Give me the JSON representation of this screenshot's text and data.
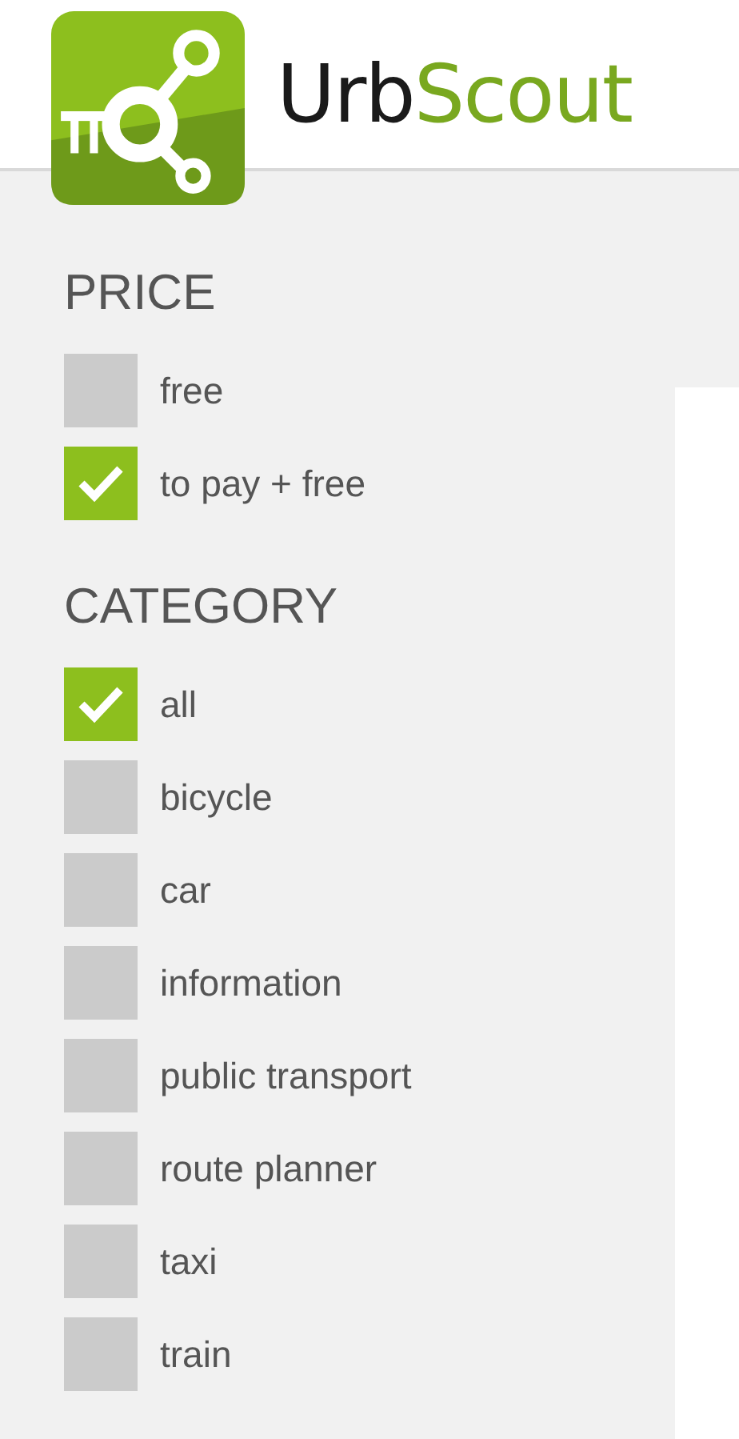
{
  "brand": {
    "dark": "Urb",
    "accent": "Scout"
  },
  "sections": [
    {
      "heading": "PRICE",
      "options": [
        {
          "label": "free",
          "checked": false
        },
        {
          "label": "to pay + free",
          "checked": true
        }
      ]
    },
    {
      "heading": "CATEGORY",
      "options": [
        {
          "label": "all",
          "checked": true
        },
        {
          "label": "bicycle",
          "checked": false
        },
        {
          "label": "car",
          "checked": false
        },
        {
          "label": "information",
          "checked": false
        },
        {
          "label": "public transport",
          "checked": false
        },
        {
          "label": "route planner",
          "checked": false
        },
        {
          "label": "taxi",
          "checked": false
        },
        {
          "label": "train",
          "checked": false
        }
      ]
    }
  ]
}
